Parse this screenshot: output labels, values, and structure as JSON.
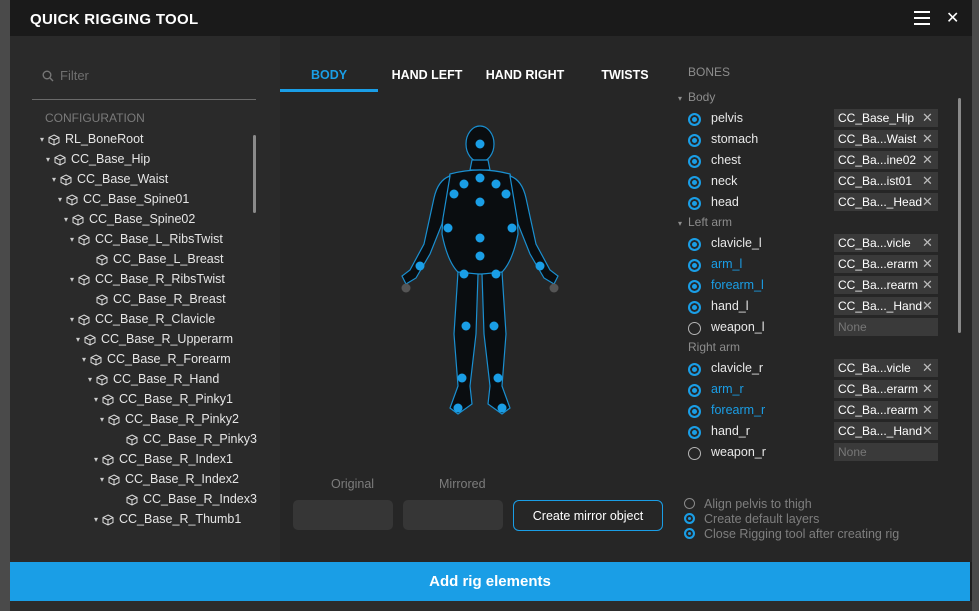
{
  "window": {
    "title": "QUICK RIGGING TOOL"
  },
  "filter": {
    "placeholder": "Filter"
  },
  "configuration": {
    "title": "CONFIGURATION"
  },
  "tree": [
    {
      "label": "RL_BoneRoot",
      "arrow": "▾"
    },
    {
      "label": "CC_Base_Hip",
      "arrow": "▾"
    },
    {
      "label": "CC_Base_Waist",
      "arrow": "▾"
    },
    {
      "label": "CC_Base_Spine01",
      "arrow": "▾"
    },
    {
      "label": "CC_Base_Spine02",
      "arrow": "▾"
    },
    {
      "label": "CC_Base_L_RibsTwist",
      "arrow": "▾"
    },
    {
      "label": "CC_Base_L_Breast",
      "arrow": ""
    },
    {
      "label": "CC_Base_R_RibsTwist",
      "arrow": "▾"
    },
    {
      "label": "CC_Base_R_Breast",
      "arrow": ""
    },
    {
      "label": "CC_Base_R_Clavicle",
      "arrow": "▾"
    },
    {
      "label": "CC_Base_R_Upperarm",
      "arrow": "▾"
    },
    {
      "label": "CC_Base_R_Forearm",
      "arrow": "▾"
    },
    {
      "label": "CC_Base_R_Hand",
      "arrow": "▾"
    },
    {
      "label": "CC_Base_R_Pinky1",
      "arrow": "▾"
    },
    {
      "label": "CC_Base_R_Pinky2",
      "arrow": "▾"
    },
    {
      "label": "CC_Base_R_Pinky3",
      "arrow": ""
    },
    {
      "label": "CC_Base_R_Index1",
      "arrow": "▾"
    },
    {
      "label": "CC_Base_R_Index2",
      "arrow": "▾"
    },
    {
      "label": "CC_Base_R_Index3",
      "arrow": ""
    },
    {
      "label": "CC_Base_R_Thumb1",
      "arrow": "▾"
    }
  ],
  "tabs": [
    {
      "label": "BODY",
      "active": true
    },
    {
      "label": "HAND LEFT",
      "active": false
    },
    {
      "label": "HAND RIGHT",
      "active": false
    },
    {
      "label": "TWISTS",
      "active": false
    }
  ],
  "mirror": {
    "original_label": "Original",
    "mirrored_label": "Mirrored",
    "create_label": "Create mirror object"
  },
  "bones": {
    "title": "BONES",
    "groups": [
      {
        "title": "Body",
        "arrow": "▾",
        "items": [
          {
            "name": "pelvis",
            "value": "CC_Base_Hip",
            "checked": true,
            "highlight": false
          },
          {
            "name": "stomach",
            "value": "CC_Ba...Waist",
            "checked": true,
            "highlight": false
          },
          {
            "name": "chest",
            "value": "CC_Ba...ine02",
            "checked": true,
            "highlight": false
          },
          {
            "name": "neck",
            "value": "CC_Ba...ist01",
            "checked": true,
            "highlight": false
          },
          {
            "name": "head",
            "value": "CC_Ba..._Head",
            "checked": true,
            "highlight": false
          }
        ]
      },
      {
        "title": "Left arm",
        "arrow": "▾",
        "items": [
          {
            "name": "clavicle_l",
            "value": "CC_Ba...vicle",
            "checked": true,
            "highlight": false
          },
          {
            "name": "arm_l",
            "value": "CC_Ba...erarm",
            "checked": true,
            "highlight": true
          },
          {
            "name": "forearm_l",
            "value": "CC_Ba...rearm",
            "checked": true,
            "highlight": true
          },
          {
            "name": "hand_l",
            "value": "CC_Ba..._Hand",
            "checked": true,
            "highlight": false
          },
          {
            "name": "weapon_l",
            "value": "None",
            "checked": false,
            "highlight": false
          }
        ]
      },
      {
        "title": "Right arm",
        "arrow": "",
        "items": [
          {
            "name": "clavicle_r",
            "value": "CC_Ba...vicle",
            "checked": true,
            "highlight": false
          },
          {
            "name": "arm_r",
            "value": "CC_Ba...erarm",
            "checked": true,
            "highlight": true
          },
          {
            "name": "forearm_r",
            "value": "CC_Ba...rearm",
            "checked": true,
            "highlight": true
          },
          {
            "name": "hand_r",
            "value": "CC_Ba..._Hand",
            "checked": true,
            "highlight": false
          },
          {
            "name": "weapon_r",
            "value": "None",
            "checked": false,
            "highlight": false
          }
        ]
      }
    ],
    "clear_glyph": "✕"
  },
  "options": [
    {
      "label": "Align pelvis to thigh",
      "checked": false
    },
    {
      "label": "Create default layers",
      "checked": true
    },
    {
      "label": "Close Rigging tool after creating rig",
      "checked": true
    }
  ],
  "add_button": {
    "label": "Add rig elements"
  },
  "colors": {
    "accent": "#1a9ee6"
  }
}
